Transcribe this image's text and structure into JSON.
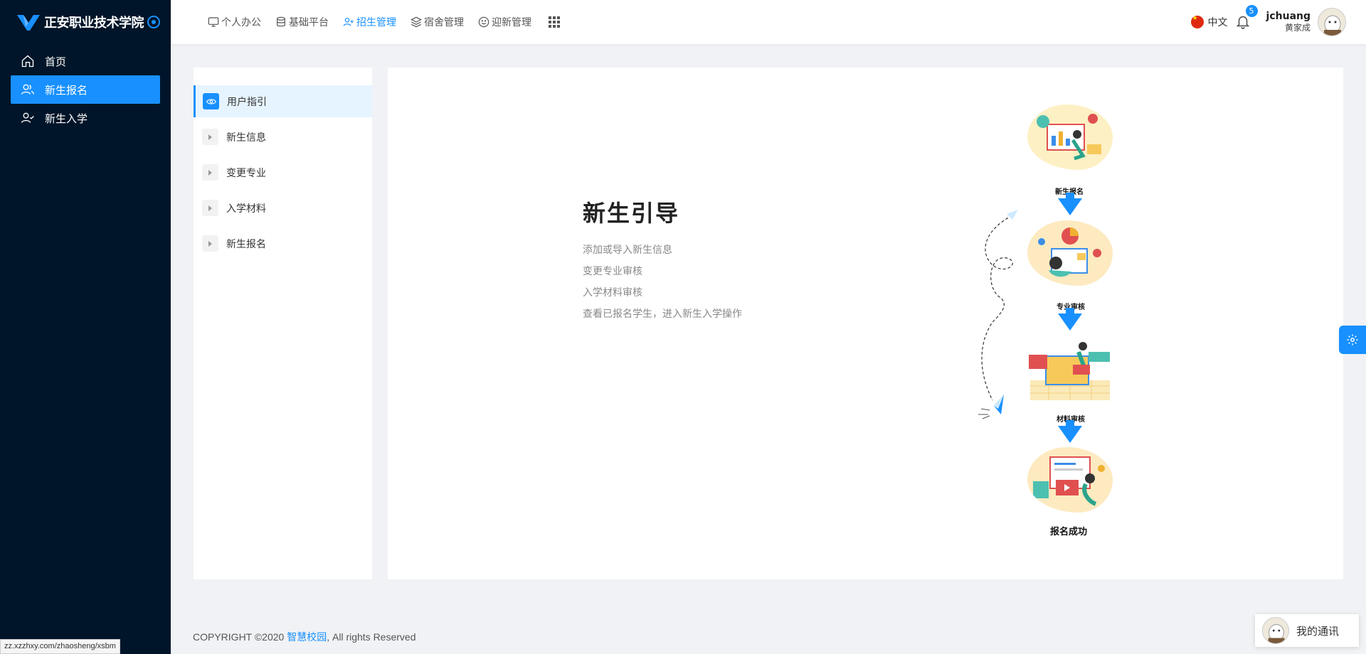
{
  "brand": {
    "name": "正安职业技术学院"
  },
  "sidebar": {
    "items": [
      {
        "label": "首页",
        "icon": "home-icon"
      },
      {
        "label": "新生报名",
        "icon": "users-icon",
        "active": true
      },
      {
        "label": "新生入学",
        "icon": "user-check-icon"
      }
    ]
  },
  "topnav": {
    "items": [
      {
        "label": "个人办公",
        "icon": "monitor-icon"
      },
      {
        "label": "基础平台",
        "icon": "database-icon"
      },
      {
        "label": "招生管理",
        "icon": "user-plus-icon",
        "active": true
      },
      {
        "label": "宿舍管理",
        "icon": "layers-icon"
      },
      {
        "label": "迎新管理",
        "icon": "smile-icon"
      }
    ],
    "apps_icon": "grid-icon"
  },
  "header": {
    "language": "中文",
    "notification_count": "5",
    "username": "jchuang",
    "realname": "黄家成"
  },
  "submenu": {
    "items": [
      {
        "label": "用户指引",
        "active": true
      },
      {
        "label": "新生信息"
      },
      {
        "label": "变更专业"
      },
      {
        "label": "入学材料"
      },
      {
        "label": "新生报名"
      }
    ]
  },
  "guide": {
    "title": "新生引导",
    "steps": [
      "添加或导入新生信息",
      "变更专业审核",
      "入学材料审核",
      "查看已报名学生，进入新生入学操作"
    ]
  },
  "flow": {
    "labels": [
      "新生报名",
      "专业审核",
      "材料审核"
    ],
    "final": "报名成功"
  },
  "footer": {
    "prefix": "COPYRIGHT ©2020 ",
    "link": "智慧校园",
    "suffix": ", All rights Reserved"
  },
  "statusbar": {
    "url": "zz.xzzhxy.com/zhaosheng/xsbm"
  },
  "chat": {
    "label": "我的通讯"
  },
  "colors": {
    "primary": "#1890ff",
    "sidebar": "#001529"
  }
}
